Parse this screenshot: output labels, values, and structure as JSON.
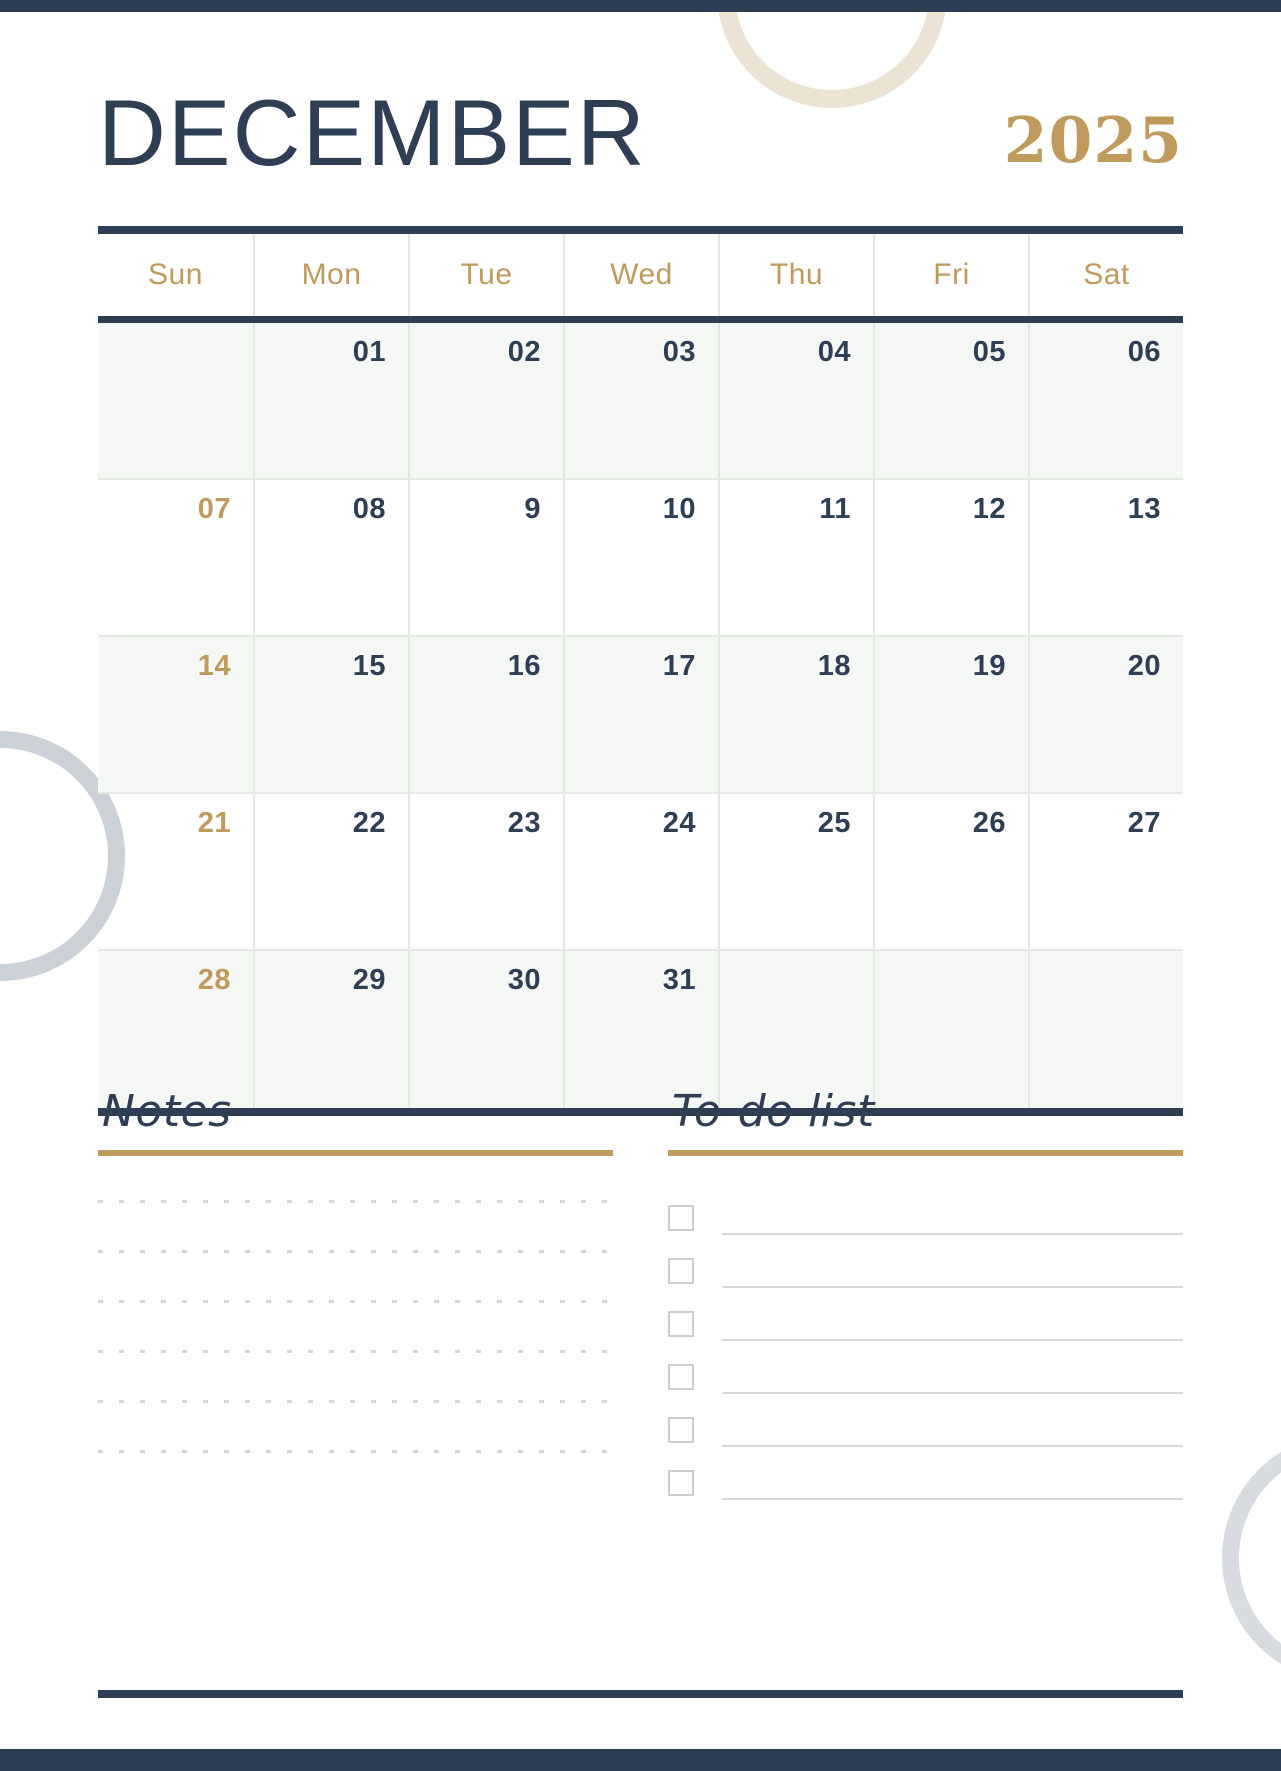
{
  "theme": {
    "navy": "#2e3f55",
    "gold": "#c09a5d",
    "grid_line": "#e2e9e1",
    "shaded_row_bg": "#f5f7f5",
    "rule_gray": "#d6d9d6"
  },
  "header": {
    "month": "DECEMBER",
    "year": "2025"
  },
  "calendar": {
    "weekdays": [
      "Sun",
      "Mon",
      "Tue",
      "Wed",
      "Thu",
      "Fri",
      "Sat"
    ],
    "weeks": [
      {
        "shaded": true,
        "days": [
          "",
          "01",
          "02",
          "03",
          "04",
          "05",
          "06"
        ]
      },
      {
        "shaded": false,
        "days": [
          "07",
          "08",
          "9",
          "10",
          "11",
          "12",
          "13"
        ]
      },
      {
        "shaded": true,
        "days": [
          "14",
          "15",
          "16",
          "17",
          "18",
          "19",
          "20"
        ]
      },
      {
        "shaded": false,
        "days": [
          "21",
          "22",
          "23",
          "24",
          "25",
          "26",
          "27"
        ]
      },
      {
        "shaded": true,
        "days": [
          "28",
          "29",
          "30",
          "31",
          "",
          "",
          ""
        ]
      }
    ]
  },
  "notes": {
    "title": "Notes",
    "line_count": 6
  },
  "todo": {
    "title": "To-do list",
    "item_count": 6
  }
}
